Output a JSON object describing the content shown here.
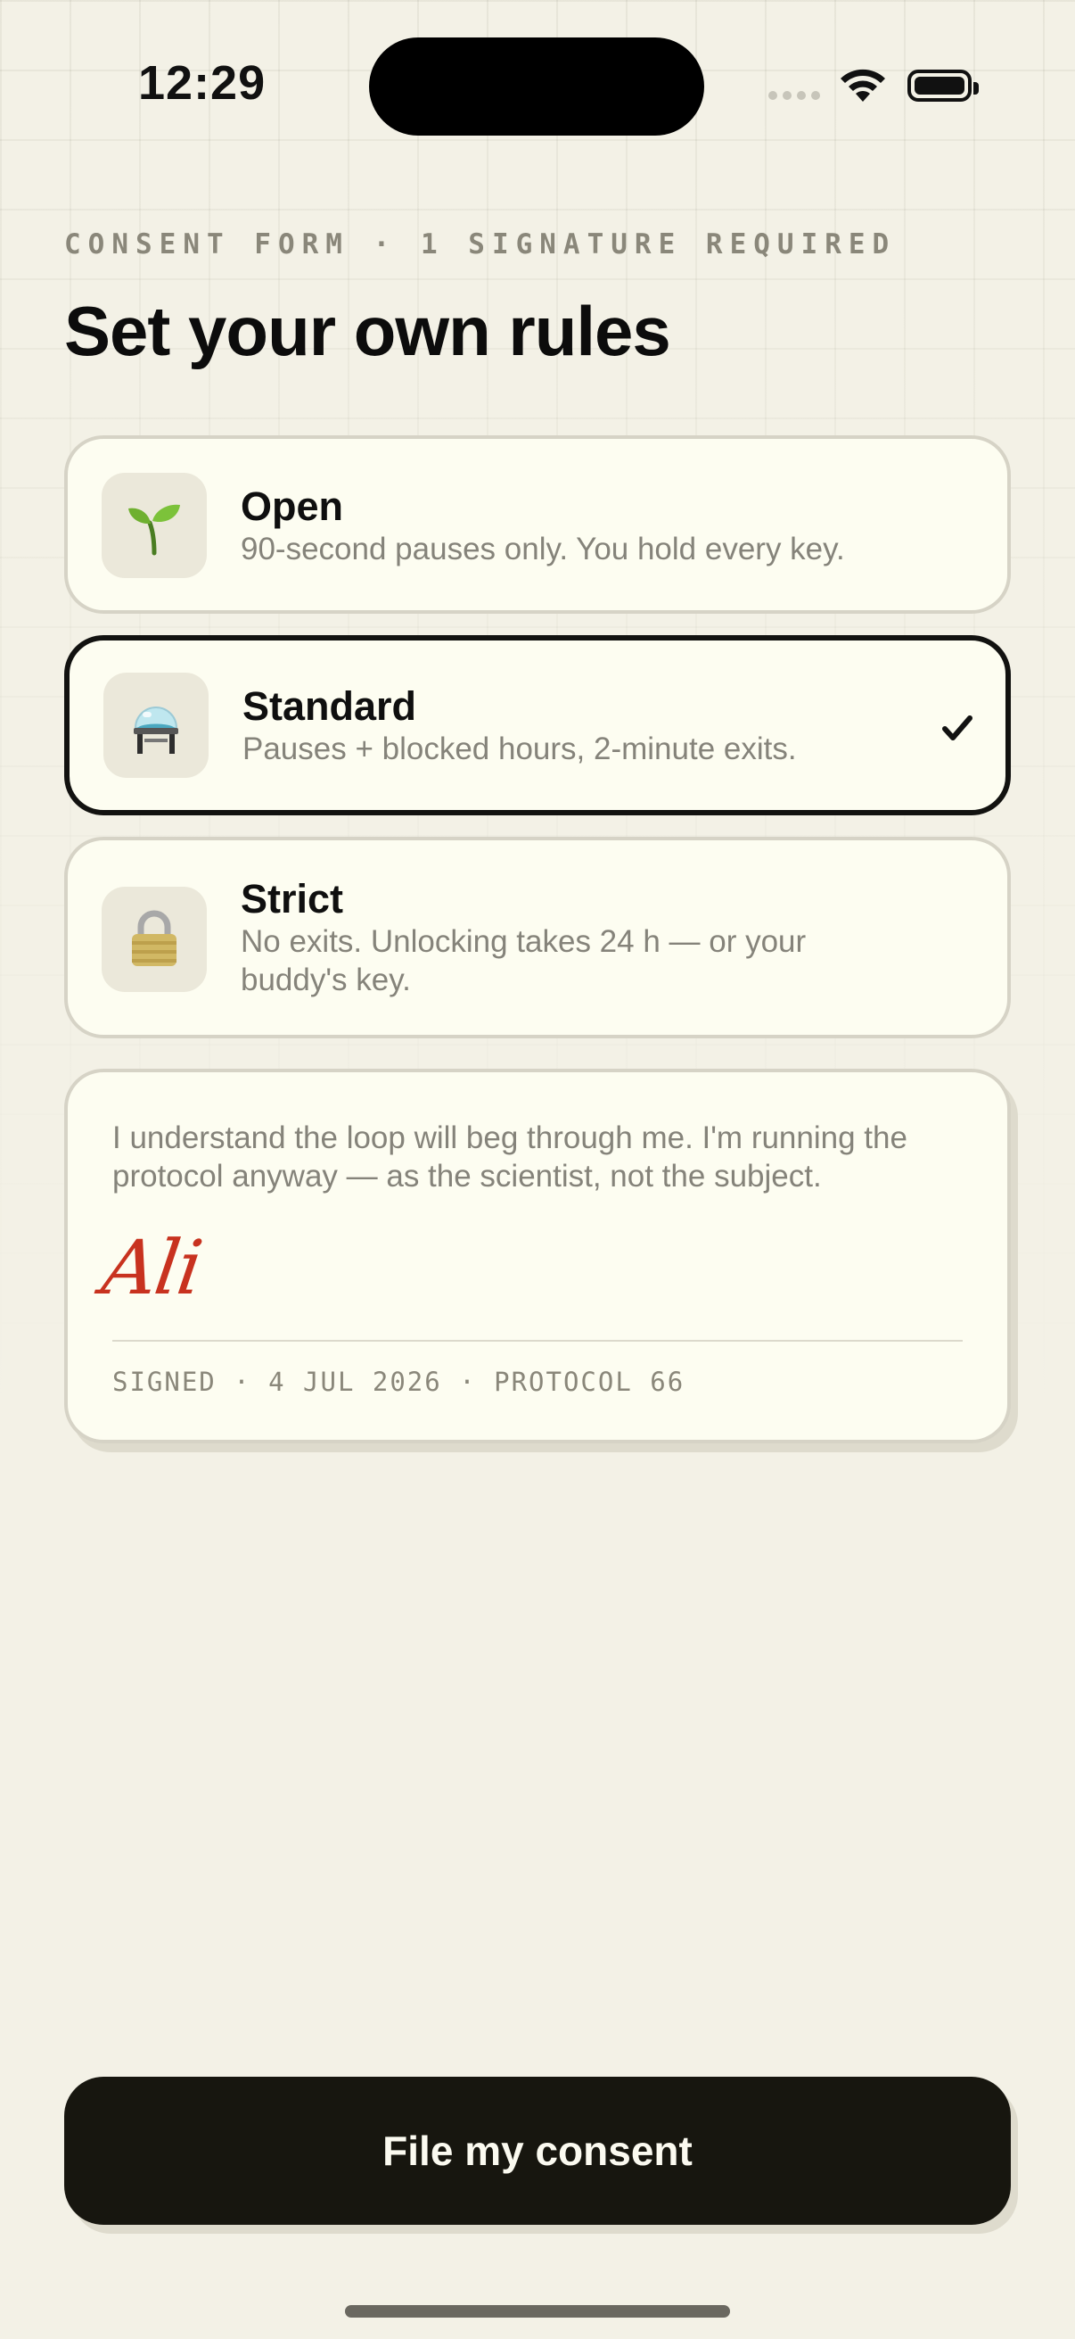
{
  "status_bar": {
    "time": "12:29"
  },
  "header": {
    "eyebrow": "CONSENT FORM · 1 SIGNATURE REQUIRED",
    "title": "Set your own rules"
  },
  "options": [
    {
      "name": "Open",
      "description": "90-second pauses only. You hold every key.",
      "icon": "🌱",
      "icon_name": "seedling-icon",
      "selected": false
    },
    {
      "name": "Standard",
      "description": "Pauses + blocked hours, 2-minute exits.",
      "icon": "🔬",
      "icon_name": "flask-icon",
      "selected": true
    },
    {
      "name": "Strict",
      "description": "No exits. Unlocking takes 24 h — or your buddy's key.",
      "icon": "🔒",
      "icon_name": "lock-icon",
      "selected": false
    }
  ],
  "consent": {
    "statement": "I understand the loop will beg through me. I'm running the protocol anyway — as the scientist, not the subject.",
    "signature": "Ali",
    "meta": "SIGNED · 4 JUL 2026 · PROTOCOL 66"
  },
  "cta": {
    "label": "File my consent"
  },
  "colors": {
    "background": "#f3f1e6",
    "card": "#fdfdf1",
    "selected_border": "#121210",
    "signature": "#c8321f",
    "button": "#17160f"
  }
}
